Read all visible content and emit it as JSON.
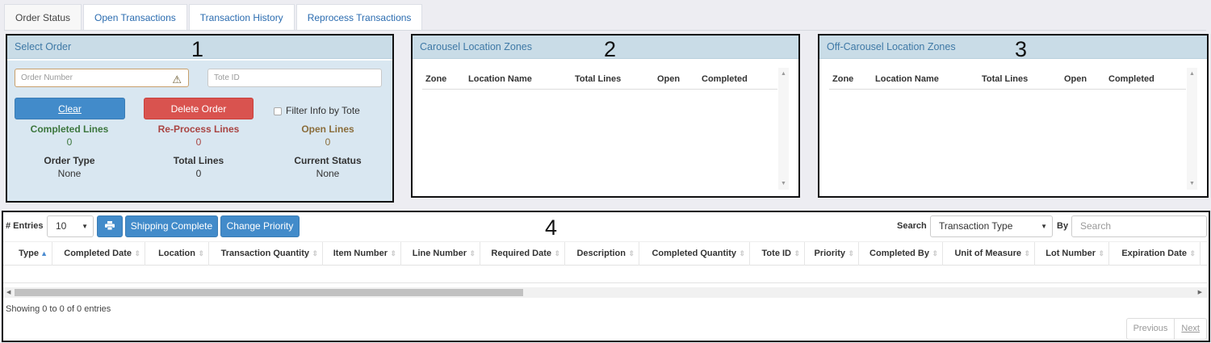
{
  "tabs": [
    {
      "label": "Order Status"
    },
    {
      "label": "Open Transactions"
    },
    {
      "label": "Transaction History"
    },
    {
      "label": "Reprocess Transactions"
    }
  ],
  "select_order": {
    "title": "Select Order",
    "number": "1",
    "order_number_placeholder": "Order Number",
    "tote_id_placeholder": "Tote ID",
    "clear_label": "Clear",
    "delete_label": "Delete Order",
    "filter_label": "Filter Info by Tote",
    "stats": {
      "completed_lines_label": "Completed Lines",
      "completed_lines_value": "0",
      "reprocess_lines_label": "Re-Process Lines",
      "reprocess_lines_value": "0",
      "open_lines_label": "Open Lines",
      "open_lines_value": "0",
      "order_type_label": "Order Type",
      "order_type_value": "None",
      "total_lines_label": "Total Lines",
      "total_lines_value": "0",
      "current_status_label": "Current Status",
      "current_status_value": "None"
    }
  },
  "carousel": {
    "title": "Carousel Location Zones",
    "number": "2",
    "columns": [
      "Zone",
      "Location Name",
      "Total Lines",
      "Open",
      "Completed"
    ]
  },
  "off_carousel": {
    "title": "Off-Carousel Location Zones",
    "number": "3",
    "columns": [
      "Zone",
      "Location Name",
      "Total Lines",
      "Open",
      "Completed"
    ]
  },
  "transactions": {
    "number": "4",
    "entries_label": "# Entries",
    "entries_value": "10",
    "shipping_complete_label": "Shipping Complete",
    "change_priority_label": "Change Priority",
    "search_label": "Search",
    "search_by_value": "Transaction Type",
    "by_label": "By",
    "search_placeholder": "Search",
    "columns": [
      "Type",
      "Completed Date",
      "Location",
      "Transaction Quantity",
      "Item Number",
      "Line Number",
      "Required Date",
      "Description",
      "Completed Quantity",
      "Tote ID",
      "Priority",
      "Completed By",
      "Unit of Measure",
      "Lot Number",
      "Expiration Date"
    ],
    "info": "Showing 0 to 0 of 0 entries",
    "previous_label": "Previous",
    "next_label": "Next"
  },
  "icons": {
    "warning": "warning-icon",
    "print": "print-icon",
    "sort": "sort-icon",
    "dropdown": "chevron-down-icon"
  }
}
